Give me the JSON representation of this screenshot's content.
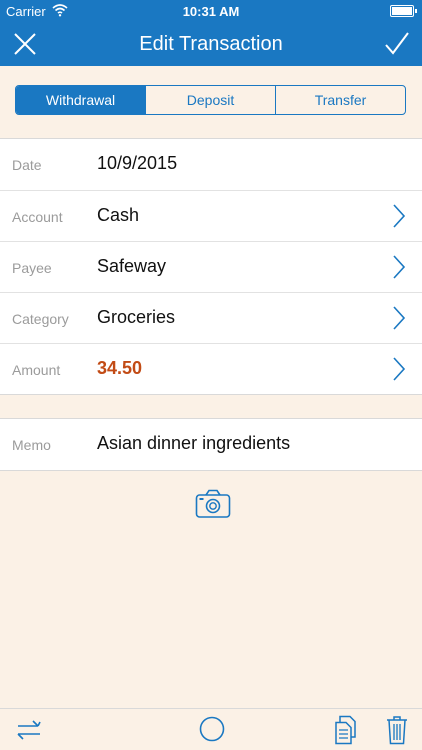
{
  "status_bar": {
    "carrier": "Carrier",
    "time": "10:31 AM"
  },
  "nav": {
    "title": "Edit Transaction",
    "left_icon": "close-icon",
    "right_icon": "checkmark-icon"
  },
  "segments": {
    "items": [
      {
        "label": "Withdrawal",
        "active": true
      },
      {
        "label": "Deposit",
        "active": false
      },
      {
        "label": "Transfer",
        "active": false
      }
    ]
  },
  "fields": {
    "date": {
      "label": "Date",
      "value": "10/9/2015"
    },
    "account": {
      "label": "Account",
      "value": "Cash"
    },
    "payee": {
      "label": "Payee",
      "value": "Safeway"
    },
    "category": {
      "label": "Category",
      "value": "Groceries"
    },
    "amount": {
      "label": "Amount",
      "value": "34.50"
    },
    "memo": {
      "label": "Memo",
      "value": "Asian dinner ingredients"
    }
  },
  "toolbar_icons": [
    "repeat-icon",
    "circle-icon",
    "copy-icon",
    "trash-icon"
  ],
  "colors": {
    "accent": "#1a78c2",
    "amount": "#c24b15",
    "background": "#fbf1e6"
  }
}
